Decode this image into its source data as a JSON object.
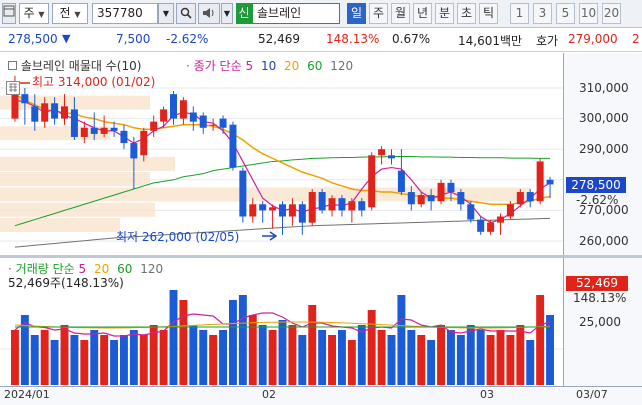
{
  "toolbar": {
    "market_label": "주",
    "prev_label": "전",
    "stock_code": "357780",
    "search_icon": "magnifier-icon",
    "dropdown_icon": "chevron-down-icon",
    "sound_icon": "speaker-icon",
    "new_badge": "신",
    "stock_name": "솔브레인",
    "period_tabs": [
      "일",
      "주",
      "월",
      "년",
      "분",
      "초",
      "틱"
    ],
    "active_period": "일",
    "interval_tabs": [
      "1",
      "3",
      "5",
      "10",
      "20"
    ]
  },
  "quote": {
    "price": "278,500",
    "direction": "▼",
    "change": "7,500",
    "change_pct": "-2.62%",
    "volume": "52,469",
    "volume_ratio": "148.13%",
    "turnover": "0.67%",
    "amount": "14,601백만",
    "ask_label": "호가",
    "ask_price": "279,000",
    "ask_extra": "2"
  },
  "price_chart": {
    "title": "솔브레인 매물대 수(10)",
    "ma_label": "종가 단순",
    "ma_periods": [
      "5",
      "10",
      "20",
      "60",
      "120"
    ],
    "ma_colors": [
      "#d0209c",
      "#1f3fb8",
      "#f0a000",
      "#1aa02a",
      "#707070"
    ],
    "high_label": "최고 314,000 (01/02)",
    "low_label": "최저 262,000 (02/05)",
    "ticks": [
      "310,000",
      "300,000",
      "290,000",
      "280,000",
      "270,000",
      "260,000"
    ],
    "current_price": "278,500",
    "current_change": "-2.62%"
  },
  "volume_chart": {
    "title": "거래량 단순",
    "ma_periods": [
      "5",
      "20",
      "60",
      "120"
    ],
    "value_label": "52,469주(148.13%)",
    "tick": "25,000",
    "current_value": "52,469",
    "current_ratio": "148.13%"
  },
  "dates": [
    "2024/01",
    "02",
    "03",
    "03/07"
  ],
  "candles": [
    {
      "o": 300000,
      "c": 309000,
      "h": 314000,
      "l": 299000
    },
    {
      "o": 308000,
      "c": 305000,
      "h": 310000,
      "l": 298000
    },
    {
      "o": 304000,
      "c": 299000,
      "h": 308000,
      "l": 296000
    },
    {
      "o": 299000,
      "c": 305000,
      "h": 307000,
      "l": 297000
    },
    {
      "o": 305000,
      "c": 300000,
      "h": 307000,
      "l": 298000
    },
    {
      "o": 300000,
      "c": 304000,
      "h": 308000,
      "l": 298000
    },
    {
      "o": 303000,
      "c": 294000,
      "h": 307000,
      "l": 293000
    },
    {
      "o": 294000,
      "c": 297000,
      "h": 299000,
      "l": 292000
    },
    {
      "o": 297000,
      "c": 295000,
      "h": 302000,
      "l": 293000
    },
    {
      "o": 295000,
      "c": 297000,
      "h": 301000,
      "l": 294000
    },
    {
      "o": 297000,
      "c": 296000,
      "h": 299000,
      "l": 294000
    },
    {
      "o": 296000,
      "c": 292000,
      "h": 298000,
      "l": 290000
    },
    {
      "o": 292000,
      "c": 287000,
      "h": 294000,
      "l": 277000
    },
    {
      "o": 288000,
      "c": 296000,
      "h": 297000,
      "l": 286000
    },
    {
      "o": 296000,
      "c": 299000,
      "h": 301000,
      "l": 294000
    },
    {
      "o": 299000,
      "c": 303000,
      "h": 304000,
      "l": 297000
    },
    {
      "o": 308000,
      "c": 300000,
      "h": 309000,
      "l": 298000
    },
    {
      "o": 300000,
      "c": 306000,
      "h": 307000,
      "l": 298000
    },
    {
      "o": 302000,
      "c": 299000,
      "h": 304000,
      "l": 296000
    },
    {
      "o": 301000,
      "c": 297000,
      "h": 302000,
      "l": 295000
    },
    {
      "o": 298000,
      "c": 298000,
      "h": 300000,
      "l": 296000
    },
    {
      "o": 300000,
      "c": 297000,
      "h": 301000,
      "l": 295000
    },
    {
      "o": 298000,
      "c": 284000,
      "h": 299000,
      "l": 283000
    },
    {
      "o": 283000,
      "c": 268000,
      "h": 284000,
      "l": 266000
    },
    {
      "o": 268000,
      "c": 272000,
      "h": 274000,
      "l": 266000
    },
    {
      "o": 272000,
      "c": 270000,
      "h": 273000,
      "l": 266000
    },
    {
      "o": 270000,
      "c": 271000,
      "h": 272000,
      "l": 264000
    },
    {
      "o": 272000,
      "c": 268000,
      "h": 273000,
      "l": 262000
    },
    {
      "o": 268000,
      "c": 272000,
      "h": 274000,
      "l": 265000
    },
    {
      "o": 272000,
      "c": 266000,
      "h": 273000,
      "l": 262000
    },
    {
      "o": 266000,
      "c": 276000,
      "h": 277000,
      "l": 265000
    },
    {
      "o": 276000,
      "c": 270000,
      "h": 277000,
      "l": 269000
    },
    {
      "o": 270000,
      "c": 274000,
      "h": 275000,
      "l": 268000
    },
    {
      "o": 274000,
      "c": 270000,
      "h": 275000,
      "l": 268000
    },
    {
      "o": 270000,
      "c": 273000,
      "h": 274000,
      "l": 266000
    },
    {
      "o": 273000,
      "c": 270000,
      "h": 274000,
      "l": 268000
    },
    {
      "o": 271000,
      "c": 288000,
      "h": 289000,
      "l": 270000
    },
    {
      "o": 288000,
      "c": 290000,
      "h": 291000,
      "l": 285000
    },
    {
      "o": 288000,
      "c": 287000,
      "h": 290000,
      "l": 285000
    },
    {
      "o": 283000,
      "c": 276000,
      "h": 290000,
      "l": 275000
    },
    {
      "o": 276000,
      "c": 272000,
      "h": 278000,
      "l": 270000
    },
    {
      "o": 272000,
      "c": 275000,
      "h": 276000,
      "l": 271000
    },
    {
      "o": 275000,
      "c": 273000,
      "h": 277000,
      "l": 270000
    },
    {
      "o": 273000,
      "c": 279000,
      "h": 280000,
      "l": 272000
    },
    {
      "o": 279000,
      "c": 276000,
      "h": 280000,
      "l": 273000
    },
    {
      "o": 276000,
      "c": 272000,
      "h": 277000,
      "l": 270000
    },
    {
      "o": 272000,
      "c": 267000,
      "h": 273000,
      "l": 266000
    },
    {
      "o": 267000,
      "c": 263000,
      "h": 268000,
      "l": 262000
    },
    {
      "o": 263000,
      "c": 266000,
      "h": 267000,
      "l": 262000
    },
    {
      "o": 266000,
      "c": 268000,
      "h": 269000,
      "l": 262000
    },
    {
      "o": 268000,
      "c": 272000,
      "h": 273000,
      "l": 267000
    },
    {
      "o": 272000,
      "c": 276000,
      "h": 277000,
      "l": 271000
    },
    {
      "o": 276000,
      "c": 273000,
      "h": 277000,
      "l": 271000
    },
    {
      "o": 273000,
      "c": 286000,
      "h": 287000,
      "l": 272000
    },
    {
      "o": 280000,
      "c": 278500,
      "h": 281000,
      "l": 274000
    }
  ],
  "volumes": [
    0.55,
    0.7,
    0.5,
    0.55,
    0.45,
    0.6,
    0.5,
    0.45,
    0.55,
    0.5,
    0.45,
    0.5,
    0.55,
    0.5,
    0.6,
    0.55,
    0.95,
    0.85,
    0.6,
    0.55,
    0.5,
    0.55,
    0.85,
    0.9,
    0.7,
    0.6,
    0.55,
    0.65,
    0.6,
    0.5,
    0.8,
    0.55,
    0.5,
    0.55,
    0.45,
    0.6,
    0.75,
    0.55,
    0.5,
    0.9,
    0.55,
    0.5,
    0.45,
    0.6,
    0.55,
    0.5,
    0.6,
    0.55,
    0.5,
    0.55,
    0.5,
    0.6,
    0.45,
    0.9,
    0.7
  ],
  "ma5": [
    306000,
    305500,
    304000,
    302000,
    303000,
    301000,
    300000,
    298500,
    297000,
    296000,
    296000,
    294000,
    292000,
    293500,
    296000,
    297500,
    301000,
    302000,
    301500,
    299000,
    298500,
    296000,
    292000,
    286000,
    280000,
    274000,
    271500,
    270000,
    270500,
    269500,
    270500,
    271000,
    272000,
    271500,
    272500,
    277000,
    281000,
    283500,
    284000,
    283500,
    280000,
    276000,
    274000,
    275000,
    276000,
    274500,
    272000,
    268000,
    266000,
    267000,
    269000,
    271500,
    274000,
    277000,
    279000
  ],
  "ma20": [
    308000,
    306000,
    304500,
    303000,
    302500,
    302000,
    301500,
    300500,
    300000,
    299000,
    298500,
    298000,
    297000,
    296500,
    296500,
    297000,
    297500,
    298000,
    298000,
    298000,
    297500,
    296500,
    295000,
    293000,
    290500,
    288500,
    287000,
    285500,
    284000,
    282500,
    281500,
    280500,
    279000,
    278000,
    277000,
    276500,
    276500,
    276000,
    276000,
    275500,
    275000,
    274500,
    274500,
    274000,
    274000,
    273500,
    273000,
    272500,
    272000,
    272000,
    272000,
    272500,
    273000,
    274000,
    274500
  ],
  "ma60": [
    265000,
    266000,
    267000,
    268000,
    269000,
    270000,
    271000,
    272000,
    273000,
    274000,
    275000,
    276000,
    277000,
    278000,
    279000,
    279500,
    280000,
    281000,
    281500,
    282000,
    283000,
    283500,
    284000,
    284500,
    285000,
    285500,
    286000,
    286200,
    286500,
    286700,
    287000,
    287100,
    287200,
    287300,
    287300,
    287400,
    287500,
    287500,
    287600,
    287600,
    287600,
    287500,
    287500,
    287400,
    287400,
    287300,
    287300,
    287200,
    287200,
    287200,
    287100,
    287100,
    287100,
    287000,
    287000
  ],
  "ma120": [
    258000,
    258300,
    258600,
    258900,
    259200,
    259500,
    259800,
    260100,
    260400,
    260700,
    261000,
    261200,
    261400,
    261600,
    261800,
    262000,
    262200,
    262400,
    262600,
    262800,
    263000,
    263200,
    263400,
    263600,
    263800,
    264000,
    264200,
    264400,
    264600,
    264800,
    265000,
    265100,
    265200,
    265300,
    265400,
    265500,
    265600,
    265700,
    265800,
    265900,
    266000,
    266100,
    266200,
    266300,
    266400,
    266500,
    266600,
    266700,
    266800,
    266900,
    267000,
    267100,
    267200,
    267300,
    267400
  ]
}
